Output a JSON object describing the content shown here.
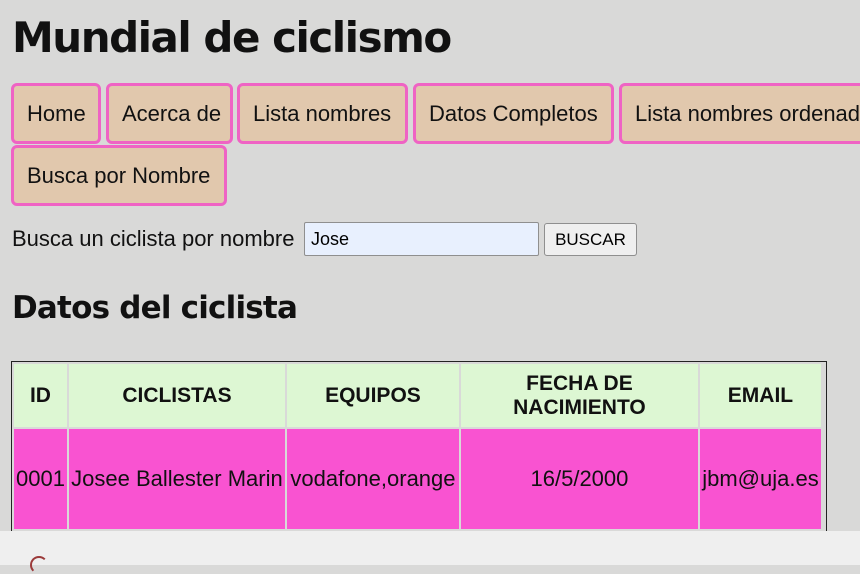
{
  "page": {
    "title": "Mundial de ciclismo"
  },
  "nav": {
    "items": [
      "Home",
      "Acerca de",
      "Lista nombres",
      "Datos Completos",
      "Lista nombres ordenados",
      "Busca por Nombre"
    ]
  },
  "search": {
    "label": "Busca un ciclista por nombre",
    "value": "Jose",
    "button": "BUSCAR"
  },
  "section": {
    "title": "Datos del ciclista"
  },
  "table": {
    "headers": [
      "ID",
      "CICLISTAS",
      "EQUIPOS",
      "FECHA DE NACIMIENTO",
      "EMAIL"
    ],
    "rows": [
      [
        "0001",
        "Josee Ballester Marin",
        "vodafone,orange",
        "16/5/2000",
        "jbm@uja.es"
      ]
    ]
  }
}
